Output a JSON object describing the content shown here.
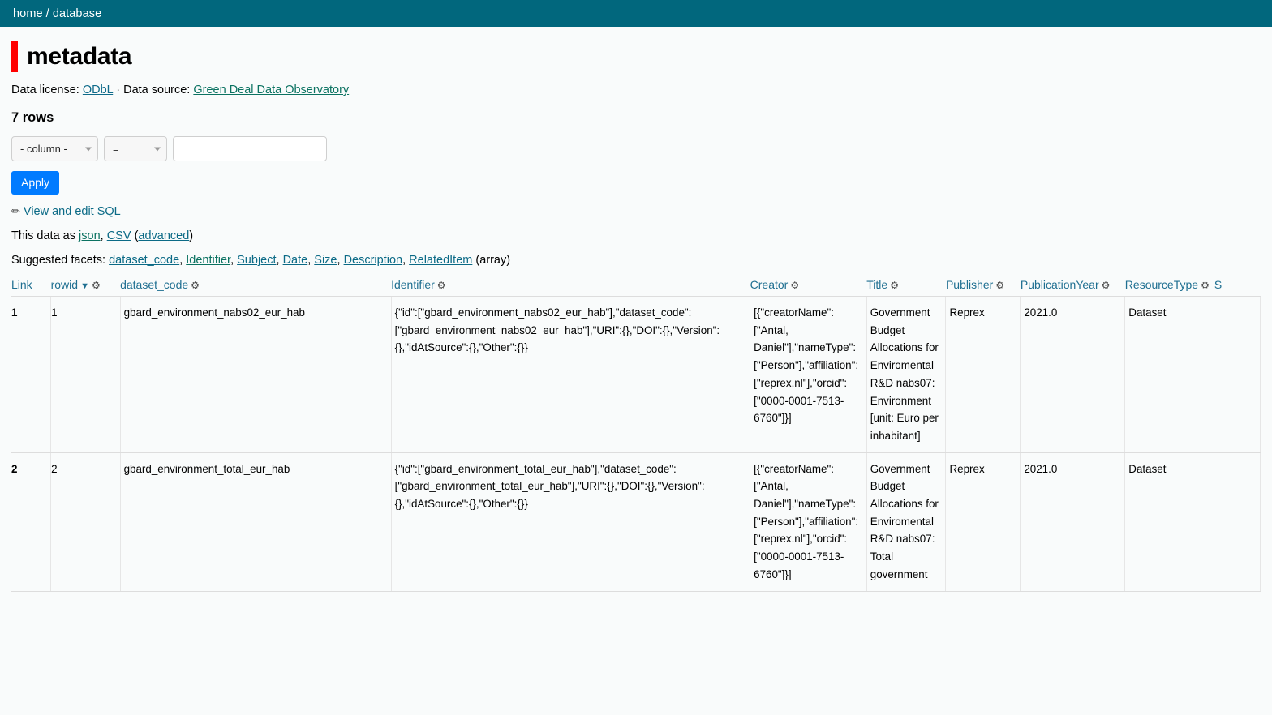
{
  "breadcrumb": {
    "home": "home",
    "separator": "/",
    "database": "database"
  },
  "page": {
    "title": "metadata",
    "license_label": "Data license:",
    "license_link": "ODbL",
    "middot": "·",
    "source_label": "Data source:",
    "source_link": "Green Deal Data Observatory",
    "row_count": "7 rows",
    "accent_color": "#ff0000",
    "topbar_color": "#01677d"
  },
  "filter": {
    "column_select": "- column -",
    "operator_select": "=",
    "value_input": "",
    "value_placeholder": "",
    "apply_label": "Apply"
  },
  "sql": {
    "pencil_icon": "✏",
    "link": "View and edit SQL"
  },
  "export": {
    "prefix": "This data as",
    "json": "json",
    "comma": ",",
    "csv": "CSV",
    "open_paren": "(",
    "advanced": "advanced",
    "close_paren": ")"
  },
  "facets": {
    "label": "Suggested facets:",
    "items": [
      "dataset_code",
      "Identifier",
      "Subject",
      "Date",
      "Size",
      "Description",
      "RelatedItem"
    ],
    "suffix": "(array)"
  },
  "table": {
    "gear_icon": "⚙",
    "sort_arrow": "▼",
    "headers": [
      {
        "label": "Link",
        "gear": false,
        "sorted": false
      },
      {
        "label": "rowid",
        "gear": true,
        "sorted": true
      },
      {
        "label": "dataset_code",
        "gear": true,
        "sorted": false
      },
      {
        "label": "Identifier",
        "gear": true,
        "sorted": false
      },
      {
        "label": "Creator",
        "gear": true,
        "sorted": false
      },
      {
        "label": "Title",
        "gear": true,
        "sorted": false
      },
      {
        "label": "Publisher",
        "gear": true,
        "sorted": false
      },
      {
        "label": "PublicationYear",
        "gear": true,
        "sorted": false
      },
      {
        "label": "ResourceType",
        "gear": true,
        "sorted": false
      },
      {
        "label": "S",
        "gear": false,
        "sorted": false
      }
    ],
    "rows": [
      {
        "link": "1",
        "rowid": "1",
        "dataset_code": "gbard_environment_nabs02_eur_hab",
        "identifier": "{\"id\":[\"gbard_environment_nabs02_eur_hab\"],\"dataset_code\":[\"gbard_environment_nabs02_eur_hab\"],\"URI\":{},\"DOI\":{},\"Version\":{},\"idAtSource\":{},\"Other\":{}}",
        "creator": "[{\"creatorName\":[\"Antal, Daniel\"],\"nameType\":[\"Person\"],\"affiliation\":[\"reprex.nl\"],\"orcid\":[\"0000-0001-7513-6760\"]}]",
        "title": "Government Budget Allocations for Enviromental R&D nabs07: Environment [unit: Euro per inhabitant]",
        "publisher": "Reprex",
        "publication_year": "2021.0",
        "resource_type": "Dataset"
      },
      {
        "link": "2",
        "rowid": "2",
        "dataset_code": "gbard_environment_total_eur_hab",
        "identifier": "{\"id\":[\"gbard_environment_total_eur_hab\"],\"dataset_code\":[\"gbard_environment_total_eur_hab\"],\"URI\":{},\"DOI\":{},\"Version\":{},\"idAtSource\":{},\"Other\":{}}",
        "creator": "[{\"creatorName\":[\"Antal, Daniel\"],\"nameType\":[\"Person\"],\"affiliation\":[\"reprex.nl\"],\"orcid\":[\"0000-0001-7513-6760\"]}]",
        "title": "Government Budget Allocations for Enviromental R&D nabs07: Total government",
        "publisher": "Reprex",
        "publication_year": "2021.0",
        "resource_type": "Dataset"
      }
    ]
  }
}
